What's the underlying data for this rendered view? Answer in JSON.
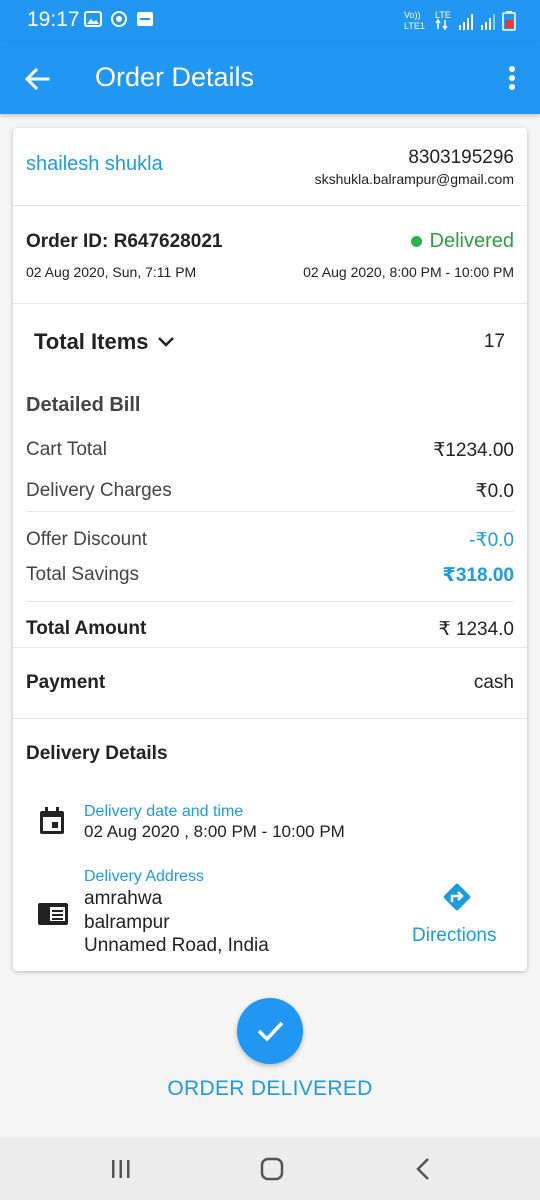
{
  "status_bar": {
    "time": "19:17",
    "icons_left": [
      "image-icon",
      "sync-icon",
      "message-icon"
    ],
    "icons_right": [
      "volte-icon",
      "lte-icon",
      "signal-icon",
      "signal-icon",
      "battery-icon"
    ],
    "volte_text": "Vo))",
    "volte_sub": "LTE1",
    "lte_text": "LTE"
  },
  "app_bar": {
    "title": "Order Details"
  },
  "customer": {
    "name": "shailesh shukla",
    "phone": "8303195296",
    "email": "skshukla.balrampur@gmail.com"
  },
  "order": {
    "id_text": "Order ID: R647628021",
    "status": "Delivered",
    "date": "02 Aug 2020, Sun, 7:11 PM",
    "slot": "02 Aug 2020, 8:00 PM - 10:00 PM"
  },
  "items": {
    "label": "Total Items",
    "count": "17"
  },
  "bill": {
    "heading": "Detailed Bill",
    "cart_total_label": "Cart Total",
    "cart_total_value": "₹1234.00",
    "delivery_label": "Delivery Charges",
    "delivery_value": "₹0.0",
    "offer_label": "Offer Discount",
    "offer_value": "-₹0.0",
    "savings_label": "Total Savings",
    "savings_value": "₹318.00",
    "total_label": "Total Amount",
    "total_value": "₹ 1234.0",
    "payment_label": "Payment",
    "payment_value": "cash"
  },
  "delivery": {
    "heading": "Delivery Details",
    "datetime_label": "Delivery date and time",
    "datetime_value": "02 Aug 2020 , 8:00 PM - 10:00 PM",
    "address_label": "Delivery Address",
    "address_lines": [
      "amrahwa",
      "balrampur",
      "Unnamed Road, India"
    ],
    "directions_label": "Directions"
  },
  "footer": {
    "action_label": "ORDER DELIVERED"
  },
  "colors": {
    "primary": "#2196f3",
    "link": "#1e9be0",
    "success": "#2e9e45"
  }
}
